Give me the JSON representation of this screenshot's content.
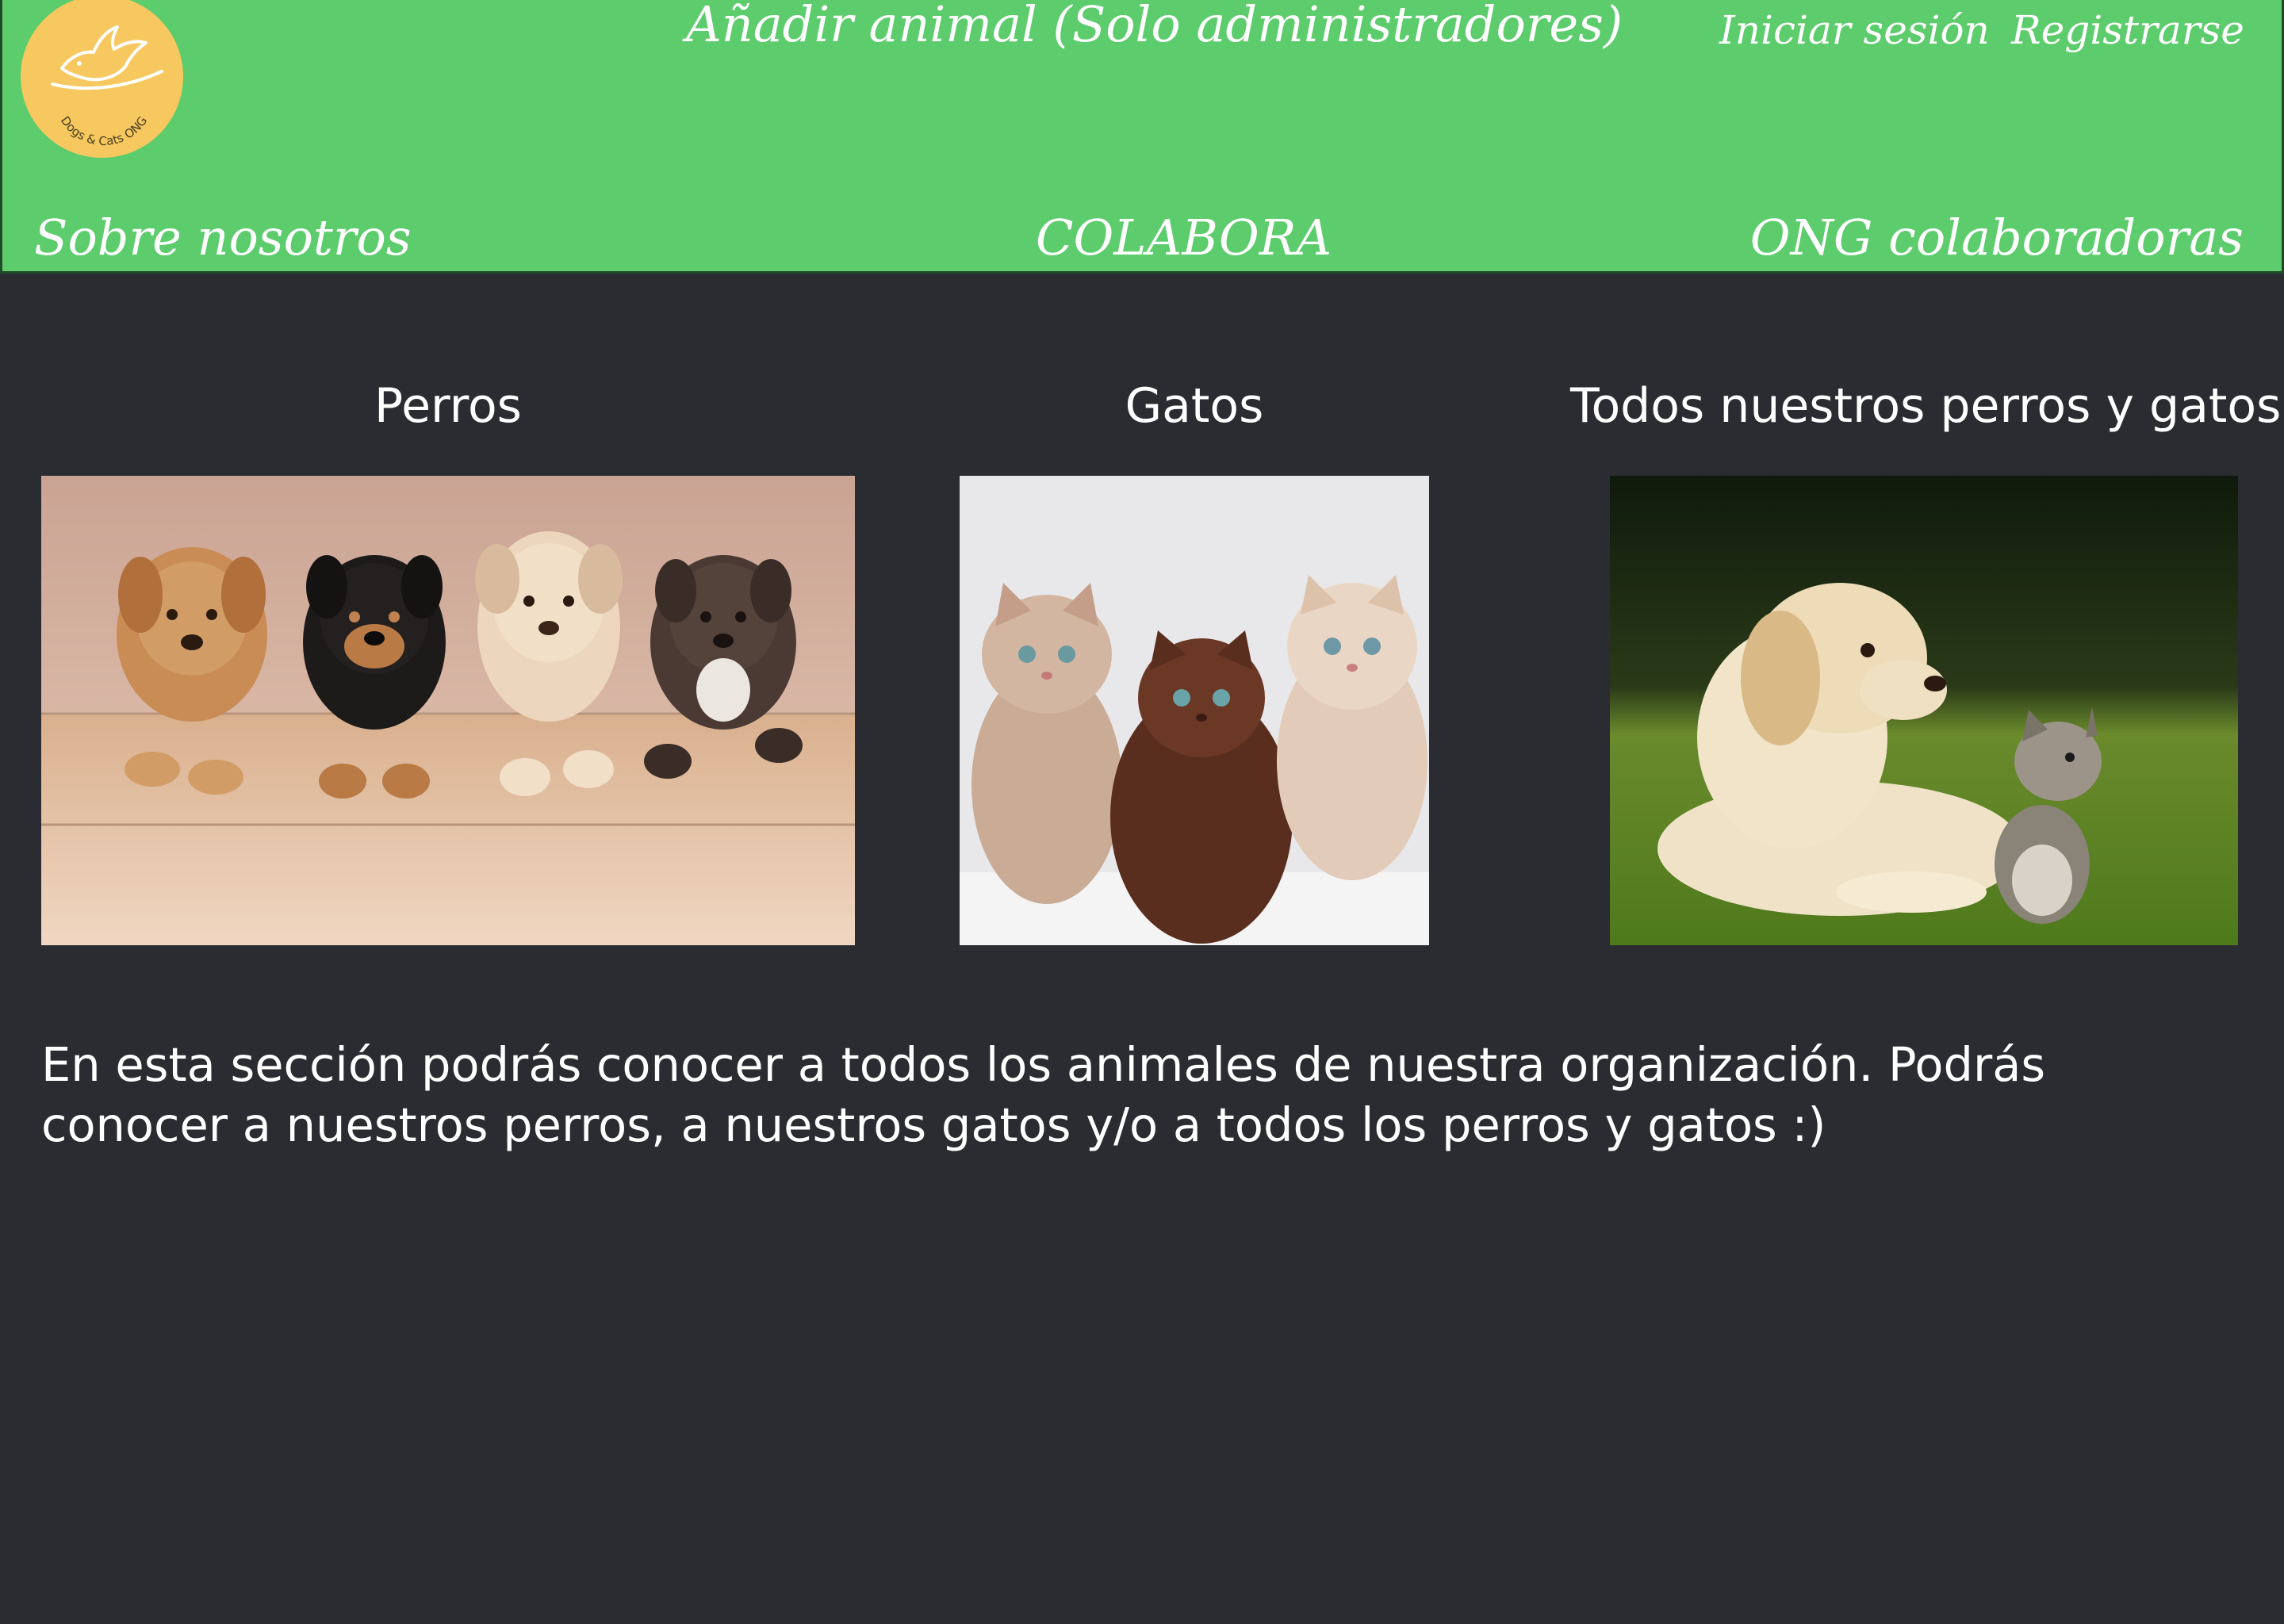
{
  "header": {
    "logo_text": "Dogs & Cats ONG",
    "add_animal": "Añadir animal (Solo administradores)",
    "login": "Iniciar sesión",
    "register": "Registrarse",
    "nav": {
      "about": "Sobre nosotros",
      "colabora": "COLABORA",
      "ong": "ONG colaboradoras"
    }
  },
  "sections": {
    "dogs": {
      "title": "Perros"
    },
    "cats": {
      "title": "Gatos"
    },
    "all": {
      "title": "Todos nuestros perros y gatos"
    }
  },
  "description": "En esta sección podrás conocer a todos los animales de nuestra organización. Podrás conocer a nuestros perros, a nuestros gatos y/o a todos los perros y gatos :)",
  "colors": {
    "header_bg": "#5ccc6c",
    "page_bg": "#2b2c31",
    "logo_bg": "#f6c85f"
  }
}
